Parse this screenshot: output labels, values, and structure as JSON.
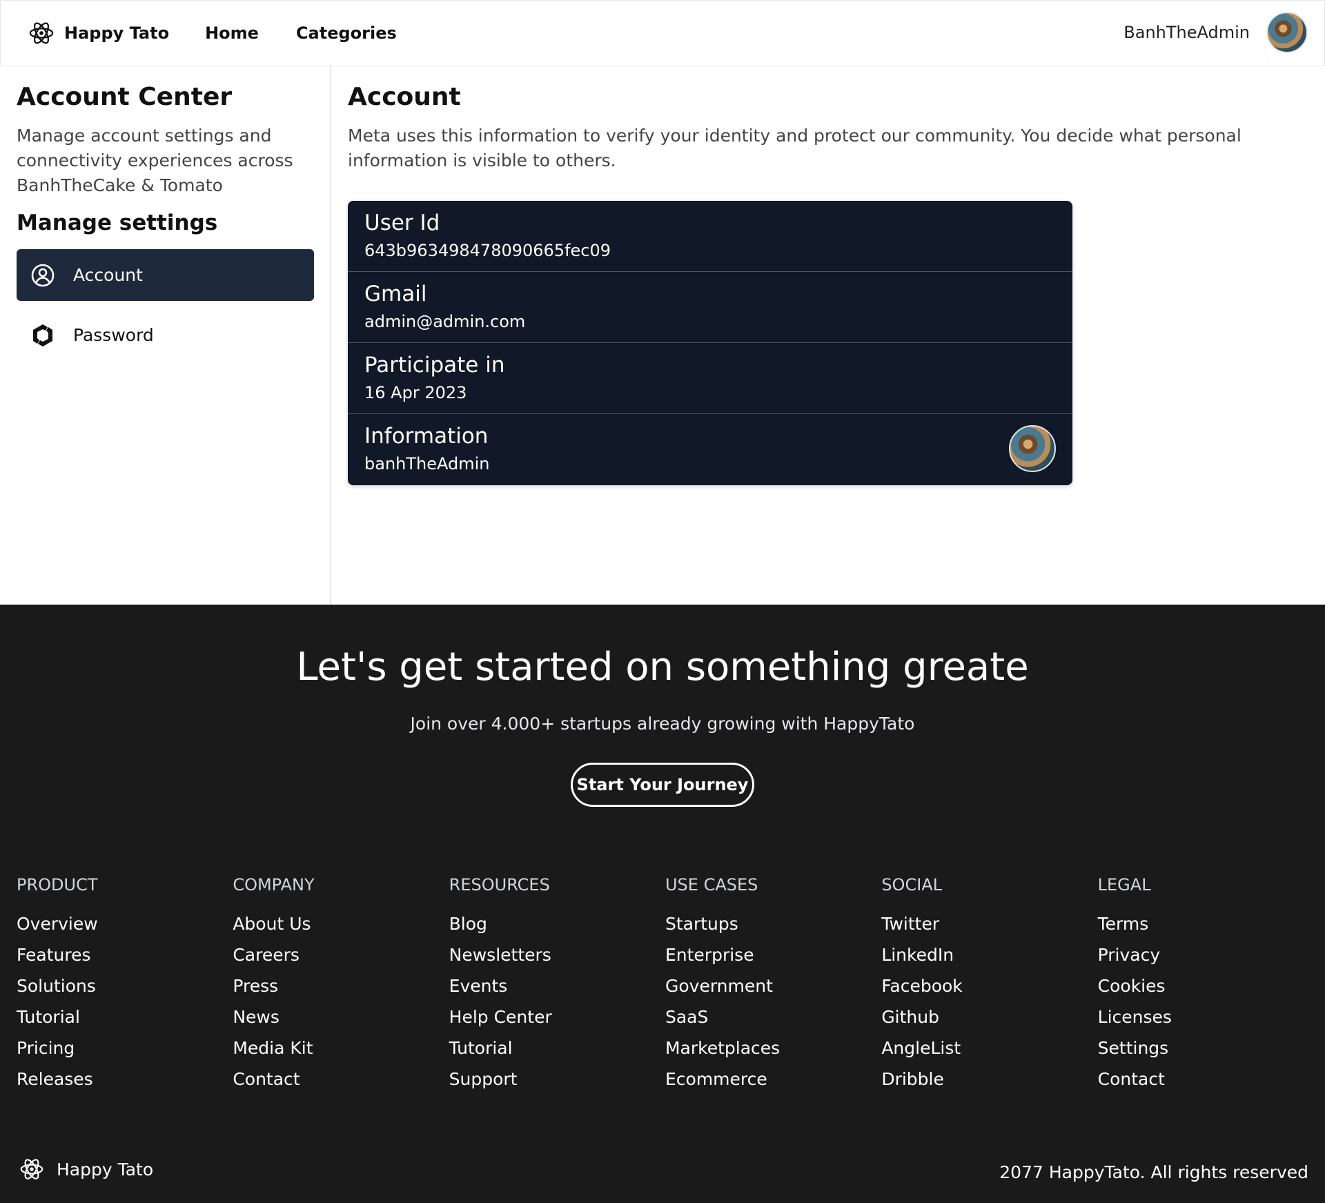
{
  "header": {
    "brand": "Happy Tato",
    "nav": [
      "Home",
      "Categories"
    ],
    "username": "BanhTheAdmin"
  },
  "sidebar": {
    "title": "Account Center",
    "description": "Manage account settings and connectivity experiences across BanhTheCake & Tomato",
    "subtitle": "Manage settings",
    "items": [
      {
        "label": "Account",
        "icon": "user-circle-icon",
        "active": true
      },
      {
        "label": "Password",
        "icon": "shield-hex-icon",
        "active": false
      }
    ]
  },
  "main": {
    "title": "Account",
    "description": "Meta uses this information to verify your identity and protect our community. You decide what personal information is visible to others.",
    "rows": [
      {
        "label": "User Id",
        "value": "643b963498478090665fec09"
      },
      {
        "label": "Gmail",
        "value": "admin@admin.com"
      },
      {
        "label": "Participate in",
        "value": "16 Apr 2023"
      },
      {
        "label": "Information",
        "value": "banhTheAdmin"
      }
    ]
  },
  "footer": {
    "cta_title": "Let's get started on something greate",
    "cta_subtitle": "Join over 4.000+ startups already growing with HappyTato",
    "cta_button": "Start Your Journey",
    "columns": [
      {
        "heading": "PRODUCT",
        "links": [
          "Overview",
          "Features",
          "Solutions",
          "Tutorial",
          "Pricing",
          "Releases"
        ]
      },
      {
        "heading": "COMPANY",
        "links": [
          "About Us",
          "Careers",
          "Press",
          "News",
          "Media Kit",
          "Contact"
        ]
      },
      {
        "heading": "RESOURCES",
        "links": [
          "Blog",
          "Newsletters",
          "Events",
          "Help Center",
          "Tutorial",
          "Support"
        ]
      },
      {
        "heading": "USE CASES",
        "links": [
          "Startups",
          "Enterprise",
          "Government",
          "SaaS",
          "Marketplaces",
          "Ecommerce"
        ]
      },
      {
        "heading": "SOCIAL",
        "links": [
          "Twitter",
          "LinkedIn",
          "Facebook",
          "Github",
          "AngleList",
          "Dribble"
        ]
      },
      {
        "heading": "LEGAL",
        "links": [
          "Terms",
          "Privacy",
          "Cookies",
          "Licenses",
          "Settings",
          "Contact"
        ]
      }
    ],
    "brand": "Happy Tato",
    "copyright": "2077 HappyTato. All rights reserved"
  }
}
